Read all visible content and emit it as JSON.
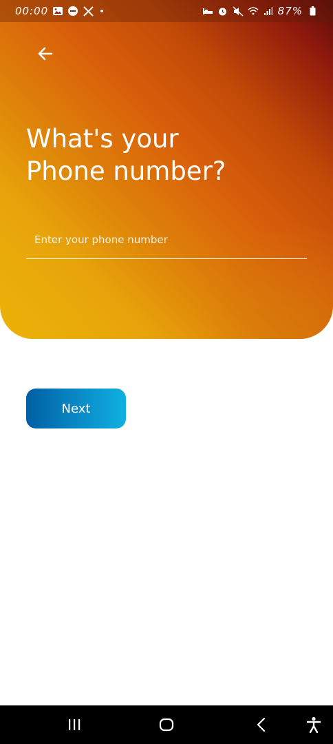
{
  "status_bar": {
    "time": "00:00",
    "battery_percent": "87%",
    "left_icons": [
      "gallery-icon",
      "do-not-disturb-icon",
      "x-app-icon",
      "notification-dot-icon"
    ],
    "right_icons": [
      "sleep-mode-icon",
      "alarm-icon",
      "mute-icon",
      "wifi-icon",
      "signal-icon",
      "battery-icon"
    ]
  },
  "header": {
    "back_icon": "arrow-left-icon",
    "title_line1": "What's your",
    "title_line2": "Phone number?"
  },
  "form": {
    "phone_value": "",
    "phone_placeholder": "Enter your phone number"
  },
  "actions": {
    "next_label": "Next"
  },
  "nav_bar": {
    "items": [
      "recent-apps-icon",
      "home-icon",
      "back-icon",
      "accessibility-icon"
    ]
  },
  "colors": {
    "gradient_dark": "#5c0a0a",
    "gradient_mid": "#d9600a",
    "gradient_light": "#eab308",
    "button_start": "#005fa3",
    "button_end": "#0fb0e0",
    "nav_bg": "#000000"
  }
}
